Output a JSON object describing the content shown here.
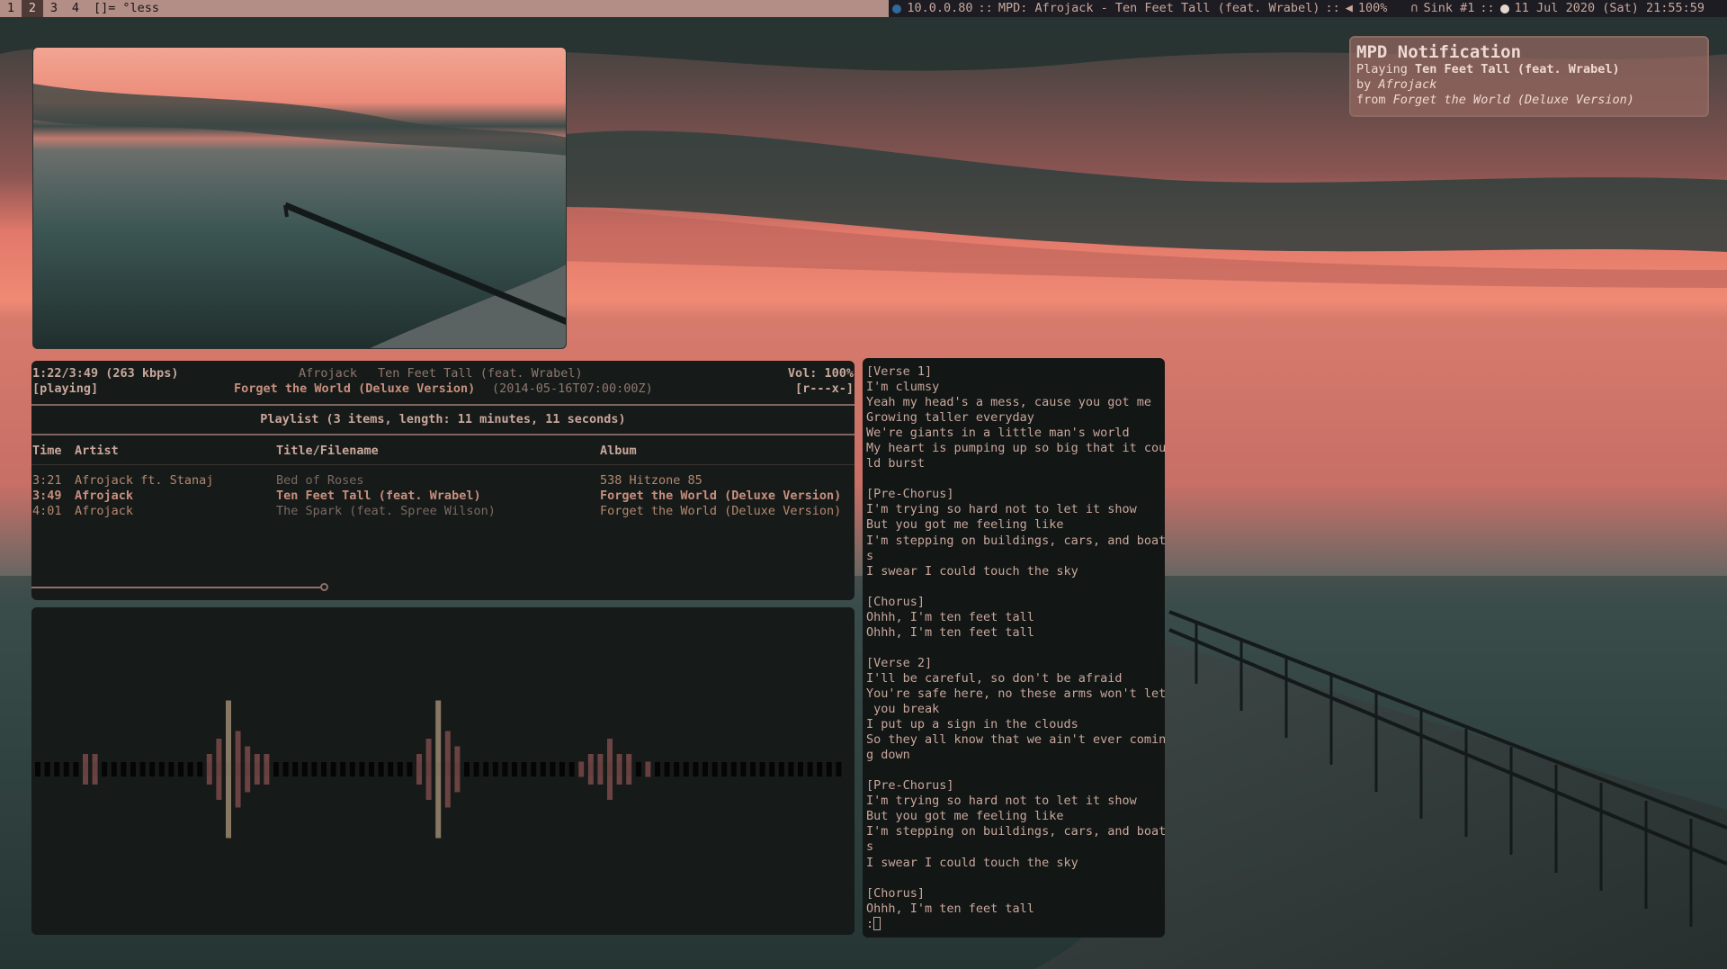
{
  "topbar": {
    "workspaces": [
      "1",
      "2",
      "3",
      "4"
    ],
    "active_workspace": "2",
    "layout_symbol": "[]=",
    "window_title": "less",
    "status": {
      "network": "10.0.0.80",
      "mpd": "MPD: Afrojack - Ten Feet Tall (feat. Wrabel)",
      "volume": "100%",
      "sink": "Sink #1",
      "datetime": "11 Jul 2020 (Sat) 21:55:59",
      "separator": "::",
      "icons": [
        "network-icon",
        "speaker-icon",
        "headphones-icon",
        "clock-icon"
      ]
    }
  },
  "notification": {
    "title": "MPD Notification",
    "playing_prefix": "Playing",
    "playing": "Ten Feet Tall (feat. Wrabel)",
    "by_prefix": "by",
    "by": "Afrojack",
    "from_prefix": "from",
    "from": "Forget the World (Deluxe Version)"
  },
  "player": {
    "elapsed": "1:22/3:49 (263 kbps)",
    "state": "[playing]",
    "artist": "Afrojack",
    "title": "Ten Feet Tall (feat. Wrabel)",
    "album": "Forget the World (Deluxe Version)",
    "date": "(2014-05-16T07:00:00Z)",
    "volume": "Vol: 100%",
    "flags": "[r---x-]",
    "progress_fraction": 0.358
  },
  "playlist": {
    "header": "Playlist (3 items, length: 11 minutes, 11 seconds)",
    "columns": [
      "Time",
      "Artist",
      "Title/Filename",
      "Album"
    ],
    "rows": [
      {
        "time": "3:21",
        "artist": "Afrojack ft. Stanaj",
        "title": "Bed of Roses",
        "album": "538 Hitzone 85",
        "current": false
      },
      {
        "time": "3:49",
        "artist": "Afrojack",
        "title": "Ten Feet Tall (feat. Wrabel)",
        "album": "Forget the World (Deluxe Version)",
        "current": true
      },
      {
        "time": "4:01",
        "artist": "Afrojack",
        "title": "The Spark (feat. Spree Wilson)",
        "album": "Forget the World (Deluxe Version)",
        "current": false
      }
    ]
  },
  "visualizer": {
    "levels": [
      0,
      0,
      0,
      0,
      0,
      2,
      2,
      0,
      0,
      0,
      0,
      0,
      0,
      0,
      0,
      0,
      0,
      0,
      2,
      4,
      9,
      5,
      3,
      2,
      2,
      0,
      0,
      0,
      0,
      0,
      0,
      0,
      0,
      0,
      0,
      0,
      0,
      0,
      0,
      0,
      2,
      4,
      9,
      5,
      3,
      0,
      0,
      0,
      0,
      0,
      0,
      0,
      0,
      0,
      0,
      0,
      0,
      1,
      2,
      2,
      4,
      2,
      2,
      0,
      1,
      0,
      0,
      0,
      0,
      0,
      0,
      0,
      0,
      0,
      0,
      0,
      0,
      0,
      0,
      0,
      0,
      0,
      0,
      0,
      0
    ],
    "colors": {
      "bar": "#7a4b4b",
      "peak": "#9b8a72",
      "base": "#050505"
    }
  },
  "lyrics": {
    "lines": [
      "[Verse 1]",
      "I'm clumsy",
      "Yeah my head's a mess, cause you got me",
      "Growing taller everyday",
      "We're giants in a little man's world",
      "My heart is pumping up so big that it cou",
      "ld burst",
      "",
      "[Pre-Chorus]",
      "I'm trying so hard not to let it show",
      "But you got me feeling like",
      "I'm stepping on buildings, cars, and boat",
      "s",
      "I swear I could touch the sky",
      "",
      "[Chorus]",
      "Ohhh, I'm ten feet tall",
      "Ohhh, I'm ten feet tall",
      "",
      "[Verse 2]",
      "I'll be careful, so don't be afraid",
      "You're safe here, no these arms won't let",
      " you break",
      "I put up a sign in the clouds",
      "So they all know that we ain't ever comin",
      "g down",
      "",
      "[Pre-Chorus]",
      "I'm trying so hard not to let it show",
      "But you got me feeling like",
      "I'm stepping on buildings, cars, and boat",
      "s",
      "I swear I could touch the sky",
      "",
      "[Chorus]",
      "Ohhh, I'm ten feet tall"
    ],
    "prompt": ":"
  }
}
